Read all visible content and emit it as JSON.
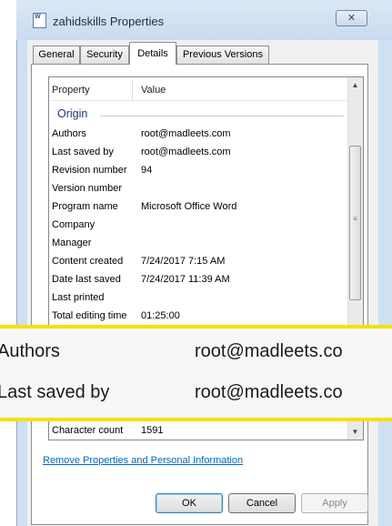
{
  "window": {
    "title": "zahidskills Properties",
    "close_glyph": "✕",
    "app_icon": "word-document-icon"
  },
  "tabs": [
    {
      "label": "General",
      "active": false
    },
    {
      "label": "Security",
      "active": false
    },
    {
      "label": "Details",
      "active": true
    },
    {
      "label": "Previous Versions",
      "active": false
    }
  ],
  "list": {
    "columns": {
      "property": "Property",
      "value": "Value"
    },
    "group": "Origin",
    "rows": [
      {
        "name": "Authors",
        "value": "root@madleets.com"
      },
      {
        "name": "Last saved by",
        "value": "root@madleets.com"
      },
      {
        "name": "Revision number",
        "value": "94"
      },
      {
        "name": "Version number",
        "value": ""
      },
      {
        "name": "Program name",
        "value": "Microsoft Office Word"
      },
      {
        "name": "Company",
        "value": ""
      },
      {
        "name": "Manager",
        "value": ""
      },
      {
        "name": "Content created",
        "value": "7/24/2017 7:15 AM"
      },
      {
        "name": "Date last saved",
        "value": "7/24/2017 11:39 AM"
      },
      {
        "name": "Last printed",
        "value": ""
      },
      {
        "name": "Total editing time",
        "value": "01:25:00"
      }
    ],
    "last_row": {
      "name": "Character count",
      "value": "1591"
    }
  },
  "zoom": {
    "rows": [
      {
        "name": "Authors",
        "value": "root@madleets.co"
      },
      {
        "name": "Last saved by",
        "value": "root@madleets.co"
      }
    ],
    "highlight_color": "#f4e200"
  },
  "footer": {
    "link": "Remove Properties and Personal Information",
    "ok": "OK",
    "cancel": "Cancel",
    "apply": "Apply"
  }
}
